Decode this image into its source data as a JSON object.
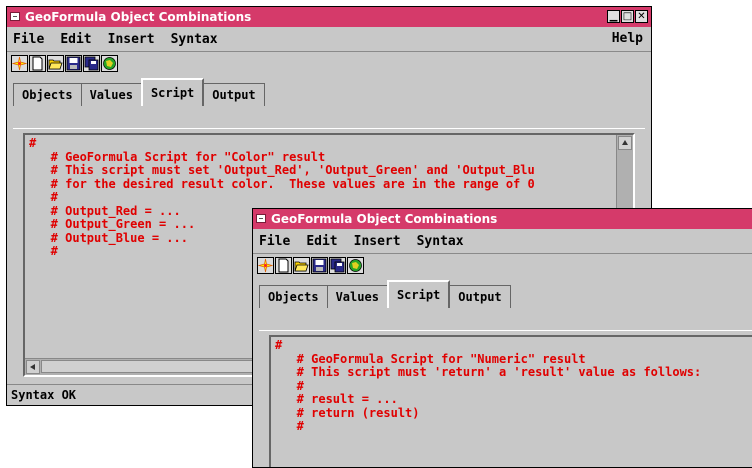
{
  "window_back": {
    "title": "GeoFormula Object Combinations",
    "menu": {
      "file": "File",
      "edit": "Edit",
      "insert": "Insert",
      "syntax": "Syntax",
      "help": "Help"
    },
    "tabs": {
      "objects": "Objects",
      "values": "Values",
      "script": "Script",
      "output": "Output"
    },
    "script_text": "#\n   # GeoFormula Script for \"Color\" result\n   # This script must set 'Output_Red', 'Output_Green' and 'Output_Blu\n   # for the desired result color.  These values are in the range of 0\n   #\n   # Output_Red = ...\n   # Output_Green = ...\n   # Output_Blue = ...\n   #",
    "status": "Syntax OK"
  },
  "window_front": {
    "title": "GeoFormula Object Combinations",
    "menu": {
      "file": "File",
      "edit": "Edit",
      "insert": "Insert",
      "syntax": "Syntax"
    },
    "tabs": {
      "objects": "Objects",
      "values": "Values",
      "script": "Script",
      "output": "Output"
    },
    "script_text": "#\n   # GeoFormula Script for \"Numeric\" result\n   # This script must 'return' a 'result' value as follows:\n   #\n   # result = ...\n   # return (result)\n   #"
  },
  "icons": [
    "new-icon",
    "blank-page-icon",
    "open-folder-icon",
    "save-icon",
    "save-as-icon",
    "run-icon"
  ],
  "colors": {
    "titlebar": "#d53a6a",
    "script_text": "#e00000",
    "window_bg": "#c8c8c8"
  }
}
